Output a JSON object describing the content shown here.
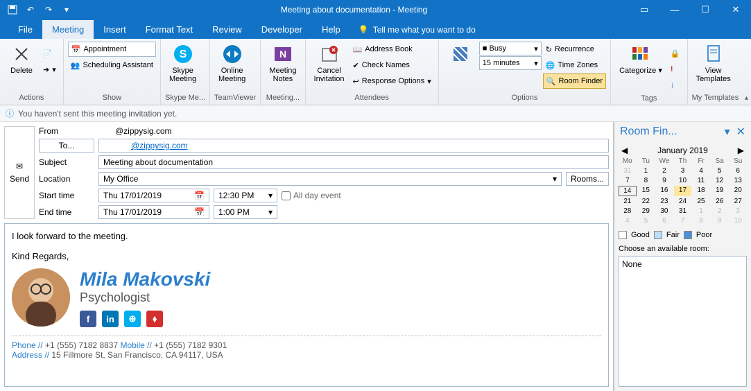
{
  "titlebar": {
    "title": "Meeting about documentation  -  Meeting"
  },
  "tabs": [
    "File",
    "Meeting",
    "Insert",
    "Format Text",
    "Review",
    "Developer",
    "Help"
  ],
  "active_tab": "Meeting",
  "tell_me": "Tell me what you want to do",
  "ribbon": {
    "actions": {
      "label": "Actions",
      "delete": "Delete"
    },
    "show": {
      "label": "Show",
      "appointment": "Appointment",
      "scheduling": "Scheduling Assistant"
    },
    "skype": {
      "label": "Skype Me...",
      "btn": "Skype\nMeeting"
    },
    "tv": {
      "label": "TeamViewer",
      "btn": "Online\nMeeting"
    },
    "notes": {
      "label": "Meeting...",
      "btn": "Meeting\nNotes"
    },
    "cancel": {
      "btn": "Cancel\nInvitation"
    },
    "attendees": {
      "label": "Attendees",
      "address": "Address Book",
      "check": "Check Names",
      "response": "Response Options"
    },
    "options": {
      "label": "Options",
      "busy": "Busy",
      "reminder": "15 minutes",
      "recurrence": "Recurrence",
      "tz": "Time Zones",
      "room": "Room Finder"
    },
    "tags": {
      "label": "Tags",
      "categorize": "Categorize"
    },
    "templates": {
      "label": "My Templates",
      "view": "View\nTemplates"
    }
  },
  "infobar": "You haven't sent this meeting invitation yet.",
  "compose": {
    "send": "Send",
    "from_label": "From",
    "from_value": "@zippysig.com",
    "to_label": "To...",
    "to_value": "@zippysig.com",
    "subject_label": "Subject",
    "subject_value": "Meeting about documentation",
    "location_label": "Location",
    "location_value": "My Office",
    "rooms": "Rooms...",
    "start_label": "Start time",
    "start_date": "Thu 17/01/2019",
    "start_time": "12:30 PM",
    "end_label": "End time",
    "end_date": "Thu 17/01/2019",
    "end_time": "1:00 PM",
    "allday": "All day event"
  },
  "body": {
    "line1": "I look forward to the meeting.",
    "line2": "Kind Regards,",
    "name": "Mila Makovski",
    "role": "Psychologist",
    "phone_label": "Phone // ",
    "phone": "+1 (555) 7182 8837",
    "mobile_label": " Mobile // ",
    "mobile": "+1 (555) 7182 9301",
    "address_label": "Address // ",
    "address": "15 Fillmore St, San Francisco, CA 94117, USA"
  },
  "roomfinder": {
    "title": "Room Fin...",
    "month": "January 2019",
    "dow": [
      "Mo",
      "Tu",
      "We",
      "Th",
      "Fr",
      "Sa",
      "Su"
    ],
    "weeks": [
      [
        "31",
        "1",
        "2",
        "3",
        "4",
        "5",
        "6"
      ],
      [
        "7",
        "8",
        "9",
        "10",
        "11",
        "12",
        "13"
      ],
      [
        "14",
        "15",
        "16",
        "17",
        "18",
        "19",
        "20"
      ],
      [
        "21",
        "22",
        "23",
        "24",
        "25",
        "26",
        "27"
      ],
      [
        "28",
        "29",
        "30",
        "31",
        "1",
        "2",
        "3"
      ],
      [
        "4",
        "5",
        "6",
        "7",
        "8",
        "9",
        "10"
      ]
    ],
    "legend": {
      "good": "Good",
      "fair": "Fair",
      "poor": "Poor"
    },
    "choose": "Choose an available room:",
    "room": "None"
  }
}
